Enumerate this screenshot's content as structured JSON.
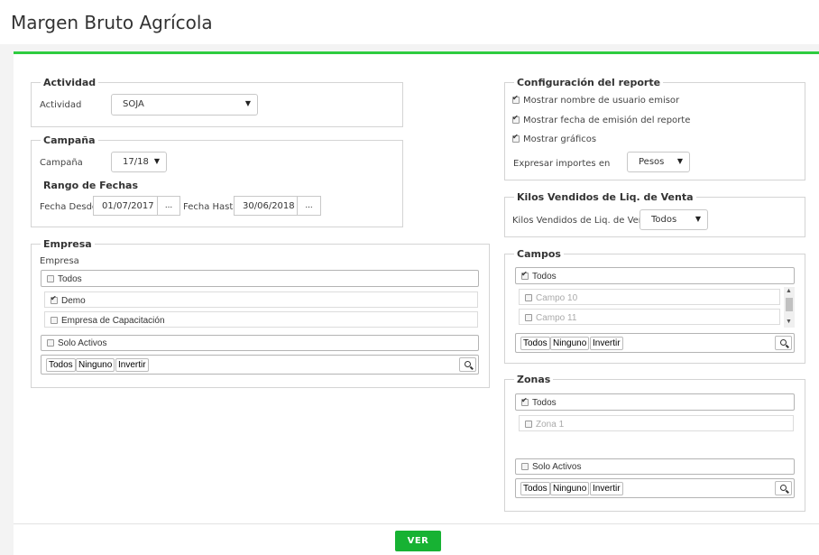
{
  "header": {
    "title": "Margen Bruto Agrícola"
  },
  "actividad": {
    "legend": "Actividad",
    "label": "Actividad",
    "value": "SOJA"
  },
  "campana": {
    "legend": "Campaña",
    "label": "Campaña",
    "value": "17/18",
    "rango_title": "Rango de Fechas",
    "desde_label": "Fecha Desde",
    "desde_value": "01/07/2017",
    "hasta_label": "Fecha Hasta",
    "hasta_value": "30/06/2018",
    "ellipsis": "..."
  },
  "empresa": {
    "legend": "Empresa",
    "label": "Empresa",
    "todos": "Todos",
    "items": [
      "Demo",
      "Empresa de Capacitación"
    ],
    "solo_activos": "Solo Activos",
    "btn_todos": "Todos",
    "btn_ninguno": "Ninguno",
    "btn_invertir": "Invertir"
  },
  "config": {
    "legend": "Configuración del reporte",
    "opt1": "Mostrar nombre de usuario emisor",
    "opt2": "Mostrar fecha de emisión del reporte",
    "opt3": "Mostrar gráficos",
    "importes_label": "Expresar importes en",
    "importes_value": "Pesos"
  },
  "kilos": {
    "legend": "Kilos Vendidos de Liq. de Venta",
    "label": "Kilos Vendidos de Liq. de Venta",
    "value": "Todos"
  },
  "campos": {
    "legend": "Campos",
    "todos": "Todos",
    "items": [
      "Campo 10",
      "Campo 11"
    ],
    "btn_todos": "Todos",
    "btn_ninguno": "Ninguno",
    "btn_invertir": "Invertir"
  },
  "zonas": {
    "legend": "Zonas",
    "todos": "Todos",
    "items": [
      "Zona 1"
    ],
    "solo_activos": "Solo Activos",
    "btn_todos": "Todos",
    "btn_ninguno": "Ninguno",
    "btn_invertir": "Invertir"
  },
  "footer": {
    "ver_label": "VER"
  },
  "colors": {
    "accent": "#2ecc40",
    "button": "#17b233"
  }
}
